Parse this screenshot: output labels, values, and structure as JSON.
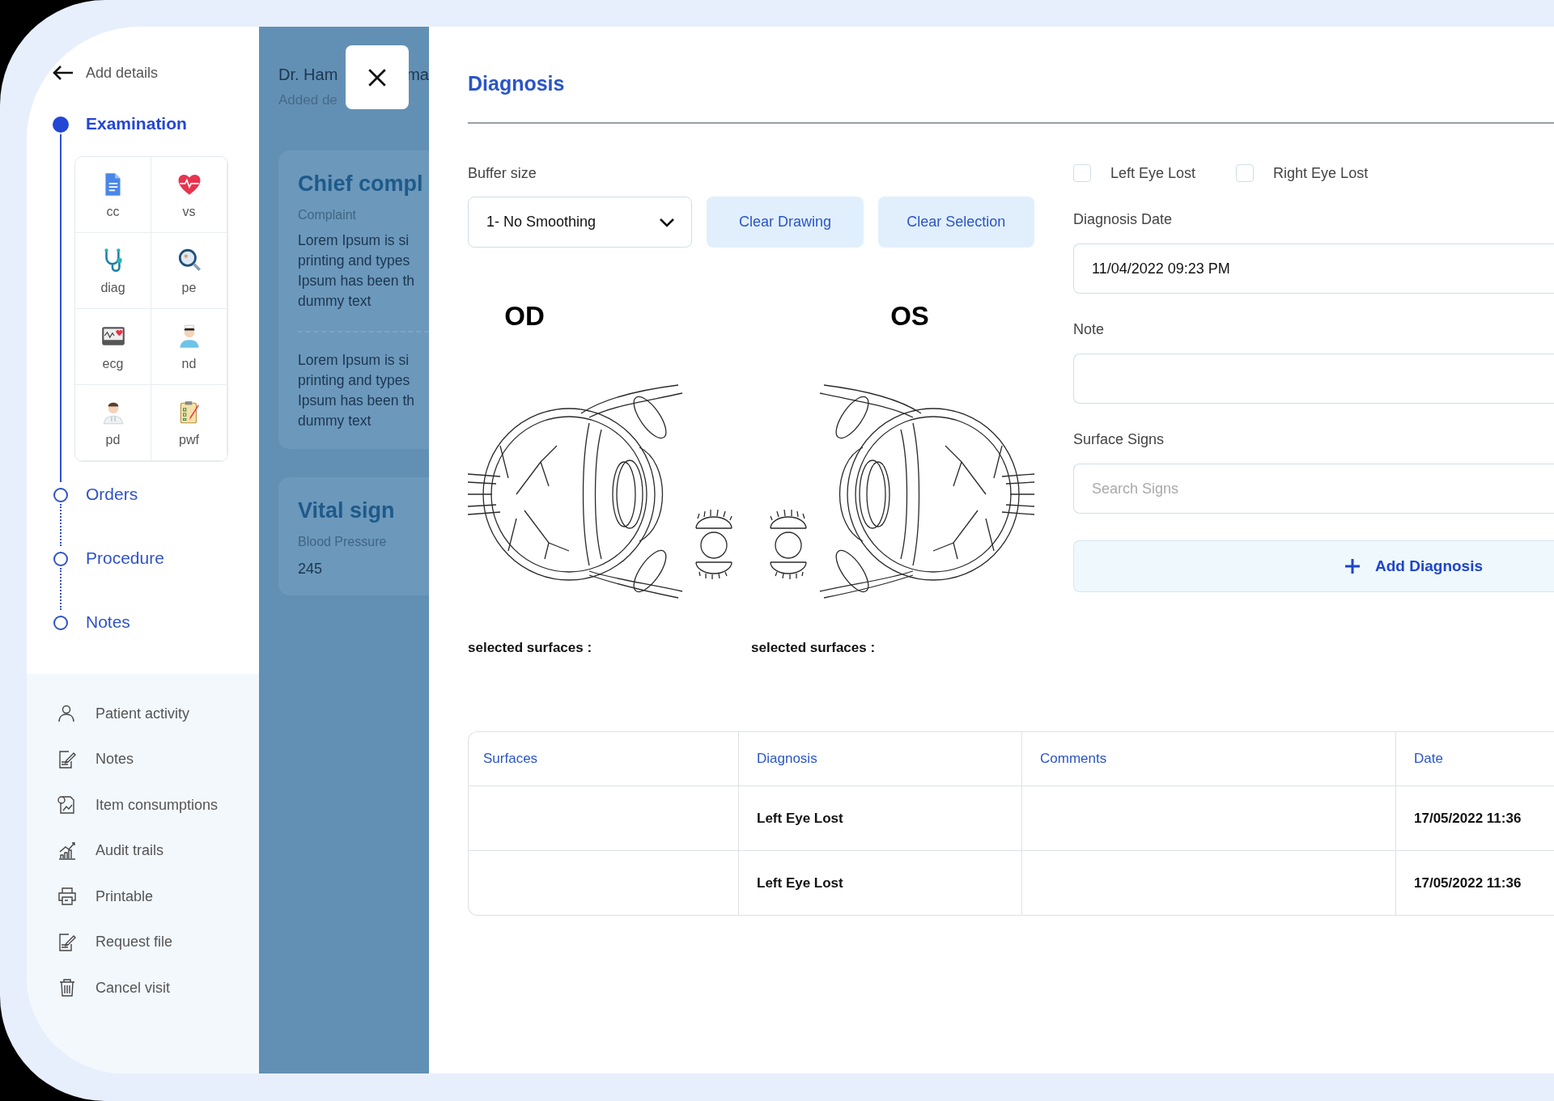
{
  "sidebar": {
    "back_label": "Add details",
    "steps": [
      {
        "label": "Examination",
        "selected": true,
        "tiles": [
          {
            "label": "cc"
          },
          {
            "label": "vs"
          },
          {
            "label": "diag"
          },
          {
            "label": "pe"
          },
          {
            "label": "ecg"
          },
          {
            "label": "nd"
          },
          {
            "label": "pd"
          },
          {
            "label": "pwf"
          }
        ]
      },
      {
        "label": "Orders",
        "selected": false
      },
      {
        "label": "Procedure",
        "selected": false
      },
      {
        "label": "Notes",
        "selected": false
      }
    ],
    "menu": [
      {
        "label": "Patient activity"
      },
      {
        "label": "Notes"
      },
      {
        "label": "Item consumptions"
      },
      {
        "label": "Audit trails"
      },
      {
        "label": "Printable"
      },
      {
        "label": "Request file"
      },
      {
        "label": "Cancel visit"
      }
    ]
  },
  "background_page": {
    "doctor_name": [
      "Dr. Ham",
      "ma"
    ],
    "subtitle": "Added de",
    "cards": [
      {
        "kind": "text",
        "title": "Chief compl",
        "label": "Complaint",
        "paragraphs": [
          "Lorem Ipsum is si\nprinting and types\nIpsum has been th\ndummy text",
          "Lorem Ipsum is si\nprinting and types\nIpsum has been th\ndummy text"
        ]
      },
      {
        "kind": "reading",
        "title": "Vital sign",
        "label": "Blood Pressure",
        "value": "245"
      }
    ]
  },
  "modal": {
    "title": "Diagnosis",
    "buffer_size": {
      "label": "Buffer size",
      "value": "1- No Smoothing"
    },
    "buttons": [
      "Clear Drawing",
      "Clear Selection"
    ],
    "eyes": [
      {
        "label": "OD",
        "selected_surfaces": "selected surfaces :"
      },
      {
        "label": "OS",
        "selected_surfaces": "selected surfaces :"
      }
    ],
    "checkboxes": [
      {
        "label": "Left Eye Lost",
        "checked": false
      },
      {
        "label": "Right Eye Lost",
        "checked": false
      }
    ],
    "fields": [
      {
        "label": "Diagnosis Date",
        "value": "11/04/2022 09:23 PM"
      },
      {
        "label": "Note"
      },
      {
        "label": "Surface Signs",
        "placeholder": "Search Signs"
      }
    ],
    "add_button": "Add Diagnosis",
    "table": {
      "columns": [
        "Surfaces",
        "Diagnosis",
        "Comments",
        "Date"
      ],
      "rows": [
        {
          "diagnosis": "Left Eye Lost",
          "date": "17/05/2022 11:36"
        },
        {
          "diagnosis": "Left Eye Lost",
          "date": "17/05/2022 11:36"
        }
      ]
    }
  }
}
